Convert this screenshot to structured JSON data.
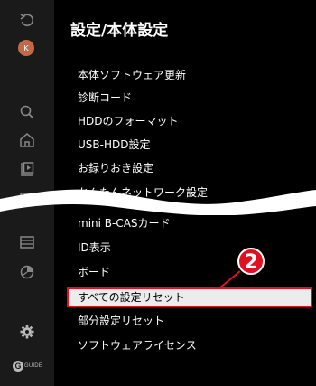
{
  "header": {
    "title": "設定/本体設定"
  },
  "sidebar": {
    "avatar_initial": "K",
    "icons": [
      "back-icon",
      "search-icon",
      "home-icon",
      "video-icon",
      "guide-table-icon",
      "list-icon",
      "clock-icon",
      "gear-icon"
    ],
    "logo_letter": "G",
    "logo_text": "GUIDE"
  },
  "menu": {
    "items": [
      {
        "label": "本体ソフトウェア更新"
      },
      {
        "label": "診断コード"
      },
      {
        "label": "HDDのフォーマット"
      },
      {
        "label": "USB-HDD設定"
      },
      {
        "label": "お録りおき設定"
      },
      {
        "label": "かんたんネットワーク設定"
      },
      {
        "label": "mini B-CASカード"
      },
      {
        "label": "ID表示"
      },
      {
        "label": "ボード"
      },
      {
        "label": "すべての設定リセット",
        "selected": true
      },
      {
        "label": "部分設定リセット"
      },
      {
        "label": "ソフトウェアライセンス"
      }
    ]
  },
  "callout": {
    "number": "2",
    "color": "#e0101e"
  },
  "colors": {
    "background": "#000000",
    "sidebar": "#1a1a1a",
    "highlight": "#e0101e",
    "selected_bg": "#ececec"
  }
}
